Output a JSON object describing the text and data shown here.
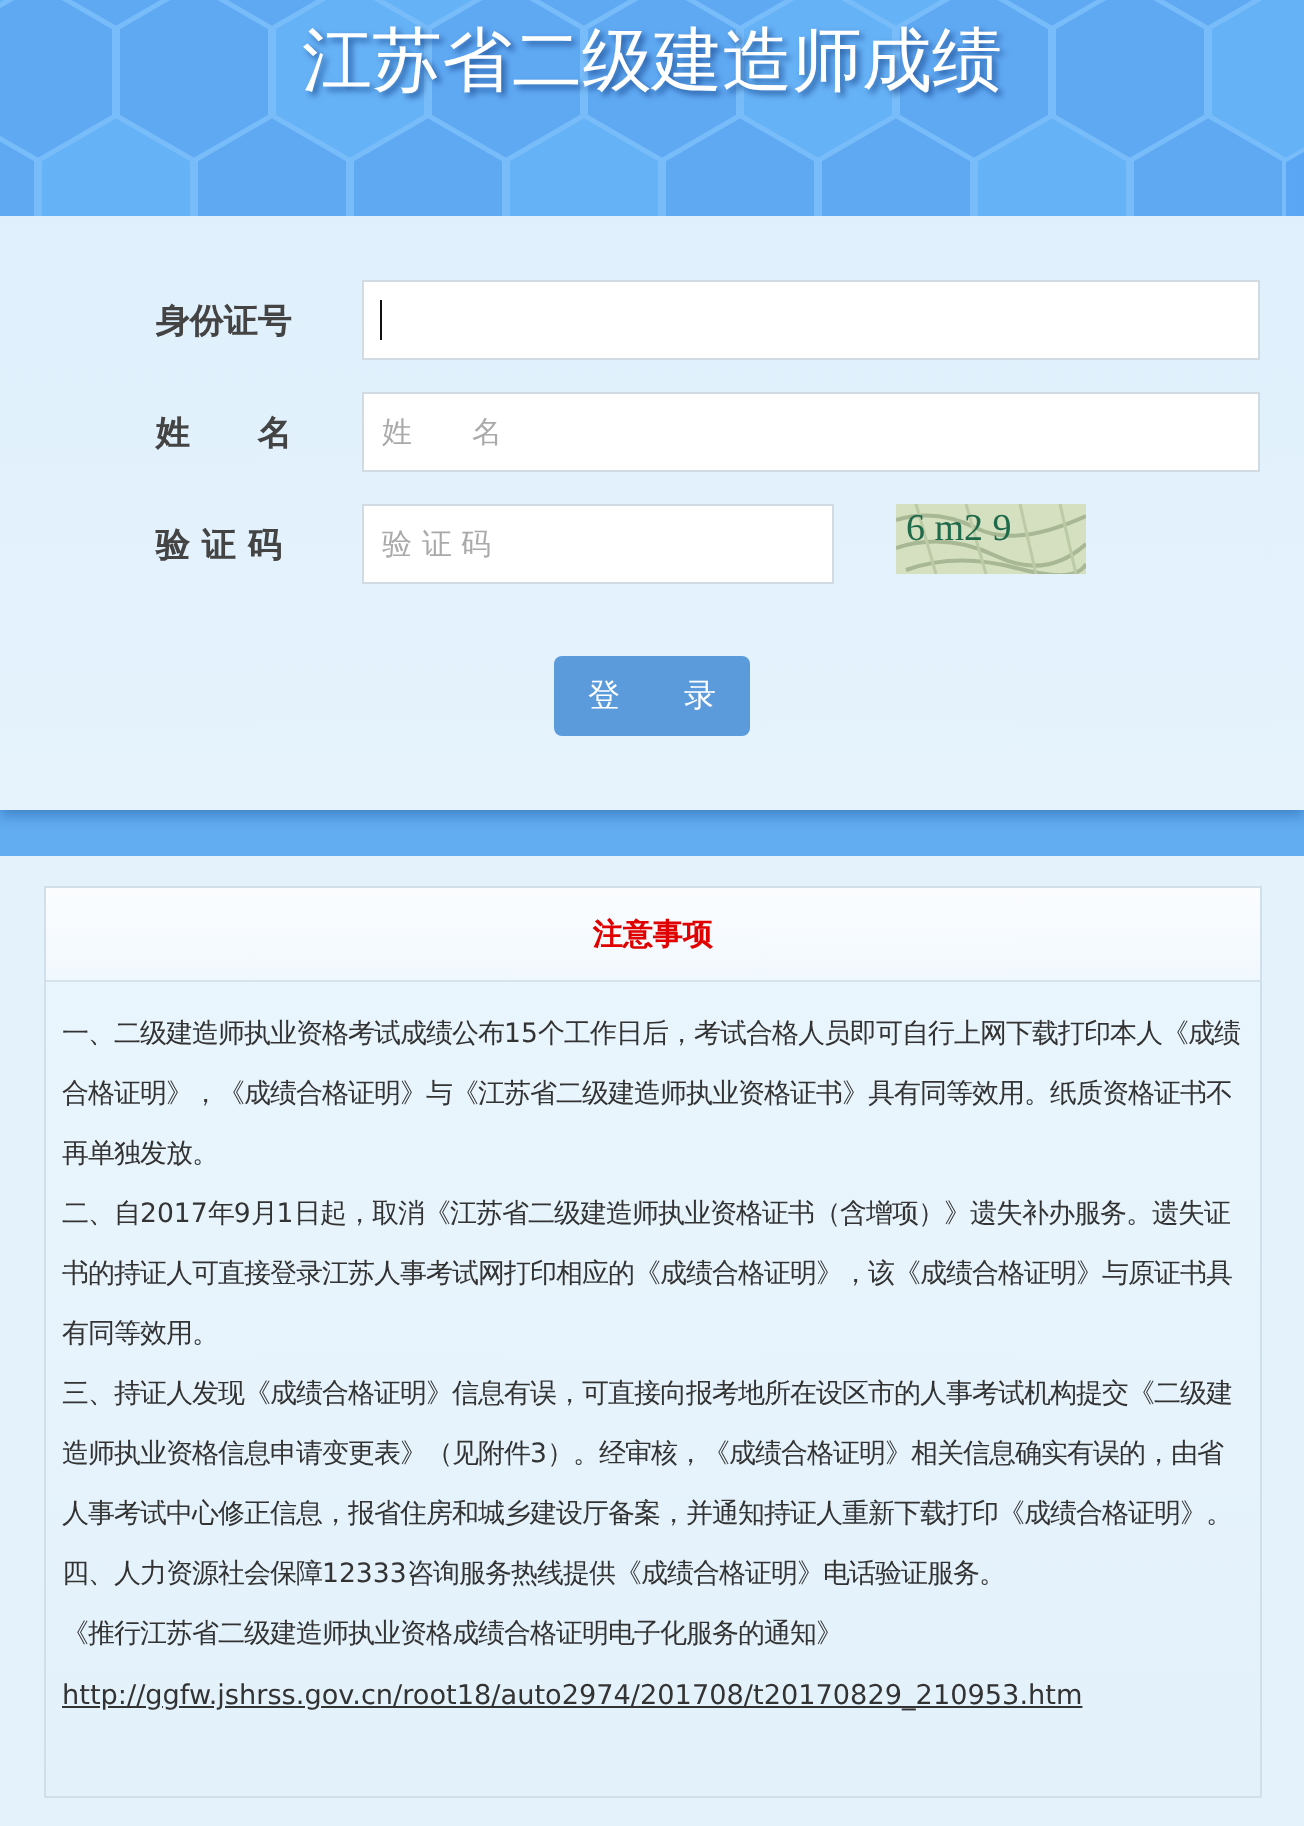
{
  "header": {
    "title": "江苏省二级建造师成绩"
  },
  "form": {
    "fields": [
      {
        "label": "身份证号",
        "focused": true,
        "kind": "text"
      },
      {
        "label": "姓　　名",
        "placeholder": "姓　　名",
        "focused": false,
        "kind": "text"
      },
      {
        "label": "验 证 码",
        "placeholder": "验 证 码",
        "focused": false,
        "kind": "captcha",
        "captcha": "6 m2 9"
      }
    ],
    "submit": "登　　录"
  },
  "notice": {
    "title": "注意事项",
    "paragraphs": [
      "一、二级建造师执业资格考试成绩公布15个工作日后，考试合格人员即可自行上网下载打印本人《成绩合格证明》，《成绩合格证明》与《江苏省二级建造师执业资格证书》具有同等效用。纸质资格证书不再单独发放。",
      "二、自2017年9月1日起，取消《江苏省二级建造师执业资格证书（含增项）》遗失补办服务。遗失证书的持证人可直接登录江苏人事考试网打印相应的《成绩合格证明》，该《成绩合格证明》与原证书具有同等效用。",
      "三、持证人发现《成绩合格证明》信息有误，可直接向报考地所在设区市的人事考试机构提交《二级建造师执业资格信息申请变更表》（见附件3）。经审核，《成绩合格证明》相关信息确实有误的，由省人事考试中心修正信息，报省住房和城乡建设厅备案，并通知持证人重新下载打印《成绩合格证明》。",
      "四、人力资源社会保障12333咨询服务热线提供《成绩合格证明》电话验证服务。",
      "《推行江苏省二级建造师执业资格成绩合格证明电子化服务的通知》"
    ],
    "link": "http://ggfw.jshrss.gov.cn/root18/auto2974/201708/t20170829_210953.htm"
  }
}
